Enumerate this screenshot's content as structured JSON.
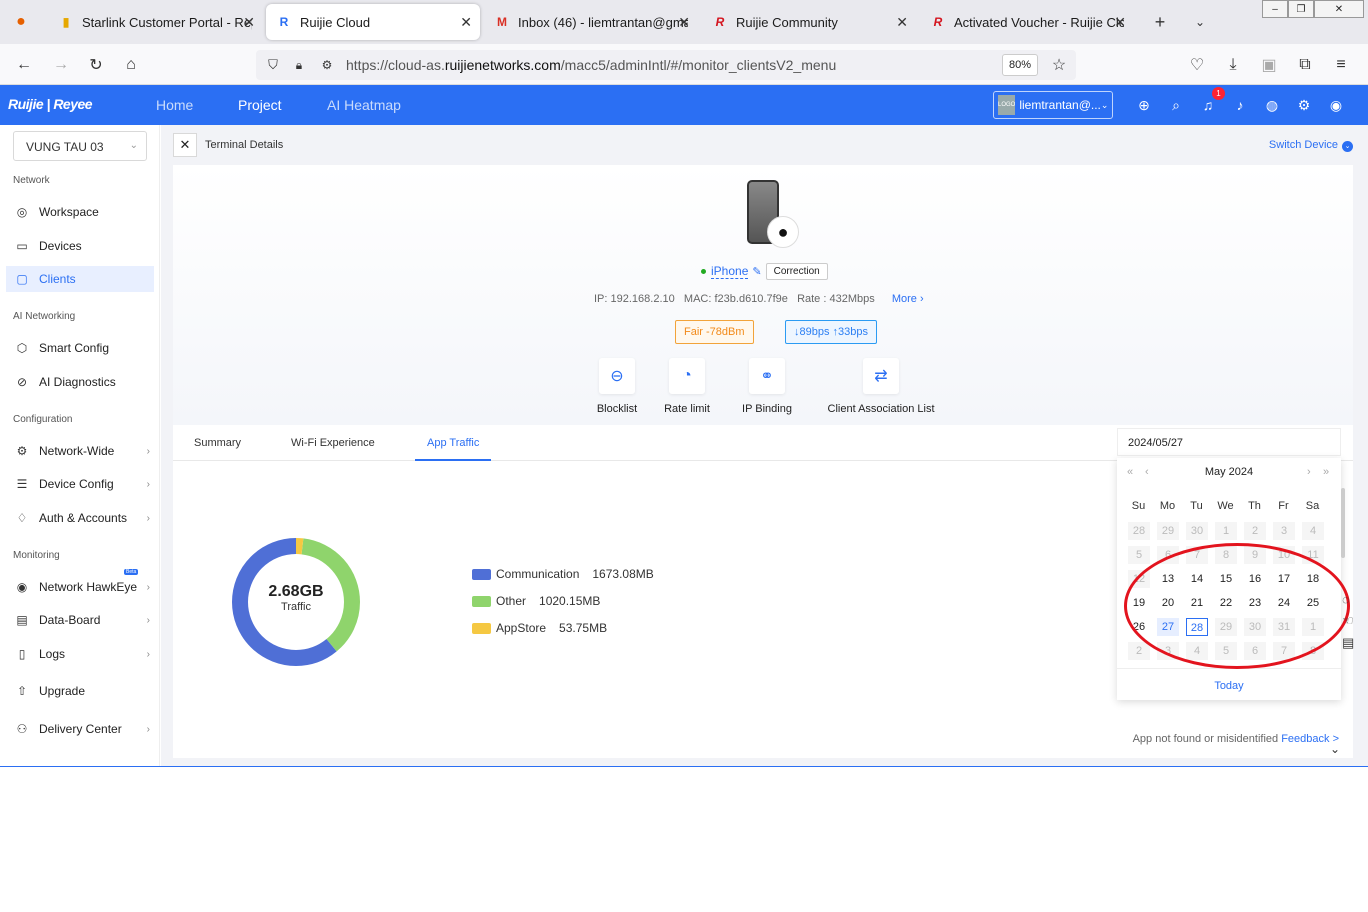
{
  "browser": {
    "tabs": [
      {
        "title": "Starlink Customer Portal - Rep",
        "icon": "starlink-icon"
      },
      {
        "title": "Ruijie Cloud",
        "icon": "ruijie-cloud-icon",
        "active": true
      },
      {
        "title": "Inbox (46) - liemtrantan@gma",
        "icon": "gmail-icon"
      },
      {
        "title": "Ruijie Community",
        "icon": "ruijie-r-icon"
      },
      {
        "title": "Activated Voucher - Ruijie Clo",
        "icon": "ruijie-r-icon"
      }
    ],
    "url_prefix": "https://cloud-as.",
    "url_domain": "ruijienetworks.com",
    "url_suffix": "/macc5/adminIntl/#/monitor_clientsV2_menu",
    "zoom": "80%"
  },
  "app": {
    "logo": "Ruijie | Reyee",
    "menu": [
      "Home",
      "Project",
      "AI Heatmap"
    ],
    "active_menu": "Project",
    "account": "liemtrantan@...",
    "account_logo": "LOGO",
    "notification_count": "1",
    "accent": "#2b6ff3"
  },
  "sidebar": {
    "project": "VUNG TAU 03",
    "sections": {
      "network": "Network",
      "ai_networking": "AI Networking",
      "configuration": "Configuration",
      "monitoring": "Monitoring"
    },
    "items": {
      "workspace": "Workspace",
      "devices": "Devices",
      "clients": "Clients",
      "smart_config": "Smart Config",
      "ai_diagnostics": "AI Diagnostics",
      "network_wide": "Network-Wide",
      "device_config": "Device Config",
      "auth_accounts": "Auth & Accounts",
      "network_hawkeye": "Network HawkEye",
      "data_board": "Data-Board",
      "logs": "Logs",
      "upgrade": "Upgrade",
      "delivery_center": "Delivery Center"
    },
    "hawkeye_badge": "Beta"
  },
  "terminal": {
    "title": "Terminal Details",
    "switch_device": "Switch Device",
    "device_name": "iPhone",
    "correction": "Correction",
    "ip_label": "IP:",
    "ip": "192.168.2.10",
    "mac_label": "MAC:",
    "mac": "f23b.d610.7f9e",
    "rate_label": "Rate :",
    "rate": "432Mbps",
    "more": "More",
    "signal_tag": "Fair -78dBm",
    "traffic_tag": "↓89bps ↑33bps",
    "actions": [
      "Blocklist",
      "Rate limit",
      "IP Binding",
      "Client Association List"
    ]
  },
  "tabs": {
    "items": [
      "Summary",
      "Wi-Fi Experience",
      "App Traffic"
    ],
    "active": "App Traffic"
  },
  "traffic": {
    "total": "2.68GB",
    "total_label": "Traffic",
    "legend": [
      {
        "name": "Communication",
        "value": "1673.08MB",
        "color": "#4f6fd6",
        "mb": 1673.08
      },
      {
        "name": "Other",
        "value": "1020.15MB",
        "color": "#8fd46c",
        "mb": 1020.15
      },
      {
        "name": "AppStore",
        "value": "53.75MB",
        "color": "#f5c842",
        "mb": 53.75
      }
    ],
    "not_found": "App not found or misidentified",
    "feedback": "Feedback >"
  },
  "datepicker": {
    "value": "2024/05/27",
    "month_label": "May 2024",
    "weekdays": [
      "Su",
      "Mo",
      "Tu",
      "We",
      "Th",
      "Fr",
      "Sa"
    ],
    "weeks": [
      [
        "28",
        "29",
        "30",
        "1",
        "2",
        "3",
        "4"
      ],
      [
        "5",
        "6",
        "7",
        "8",
        "9",
        "10",
        "11"
      ],
      [
        "12",
        "13",
        "14",
        "15",
        "16",
        "17",
        "18"
      ],
      [
        "19",
        "20",
        "21",
        "22",
        "23",
        "24",
        "25"
      ],
      [
        "26",
        "27",
        "28",
        "29",
        "30",
        "31",
        "1"
      ],
      [
        "2",
        "3",
        "4",
        "5",
        "6",
        "7",
        "8"
      ]
    ],
    "disabled_until_index": 15,
    "enabled_last_index": 30,
    "selected": "27",
    "today": "28",
    "today_label": "Today"
  }
}
